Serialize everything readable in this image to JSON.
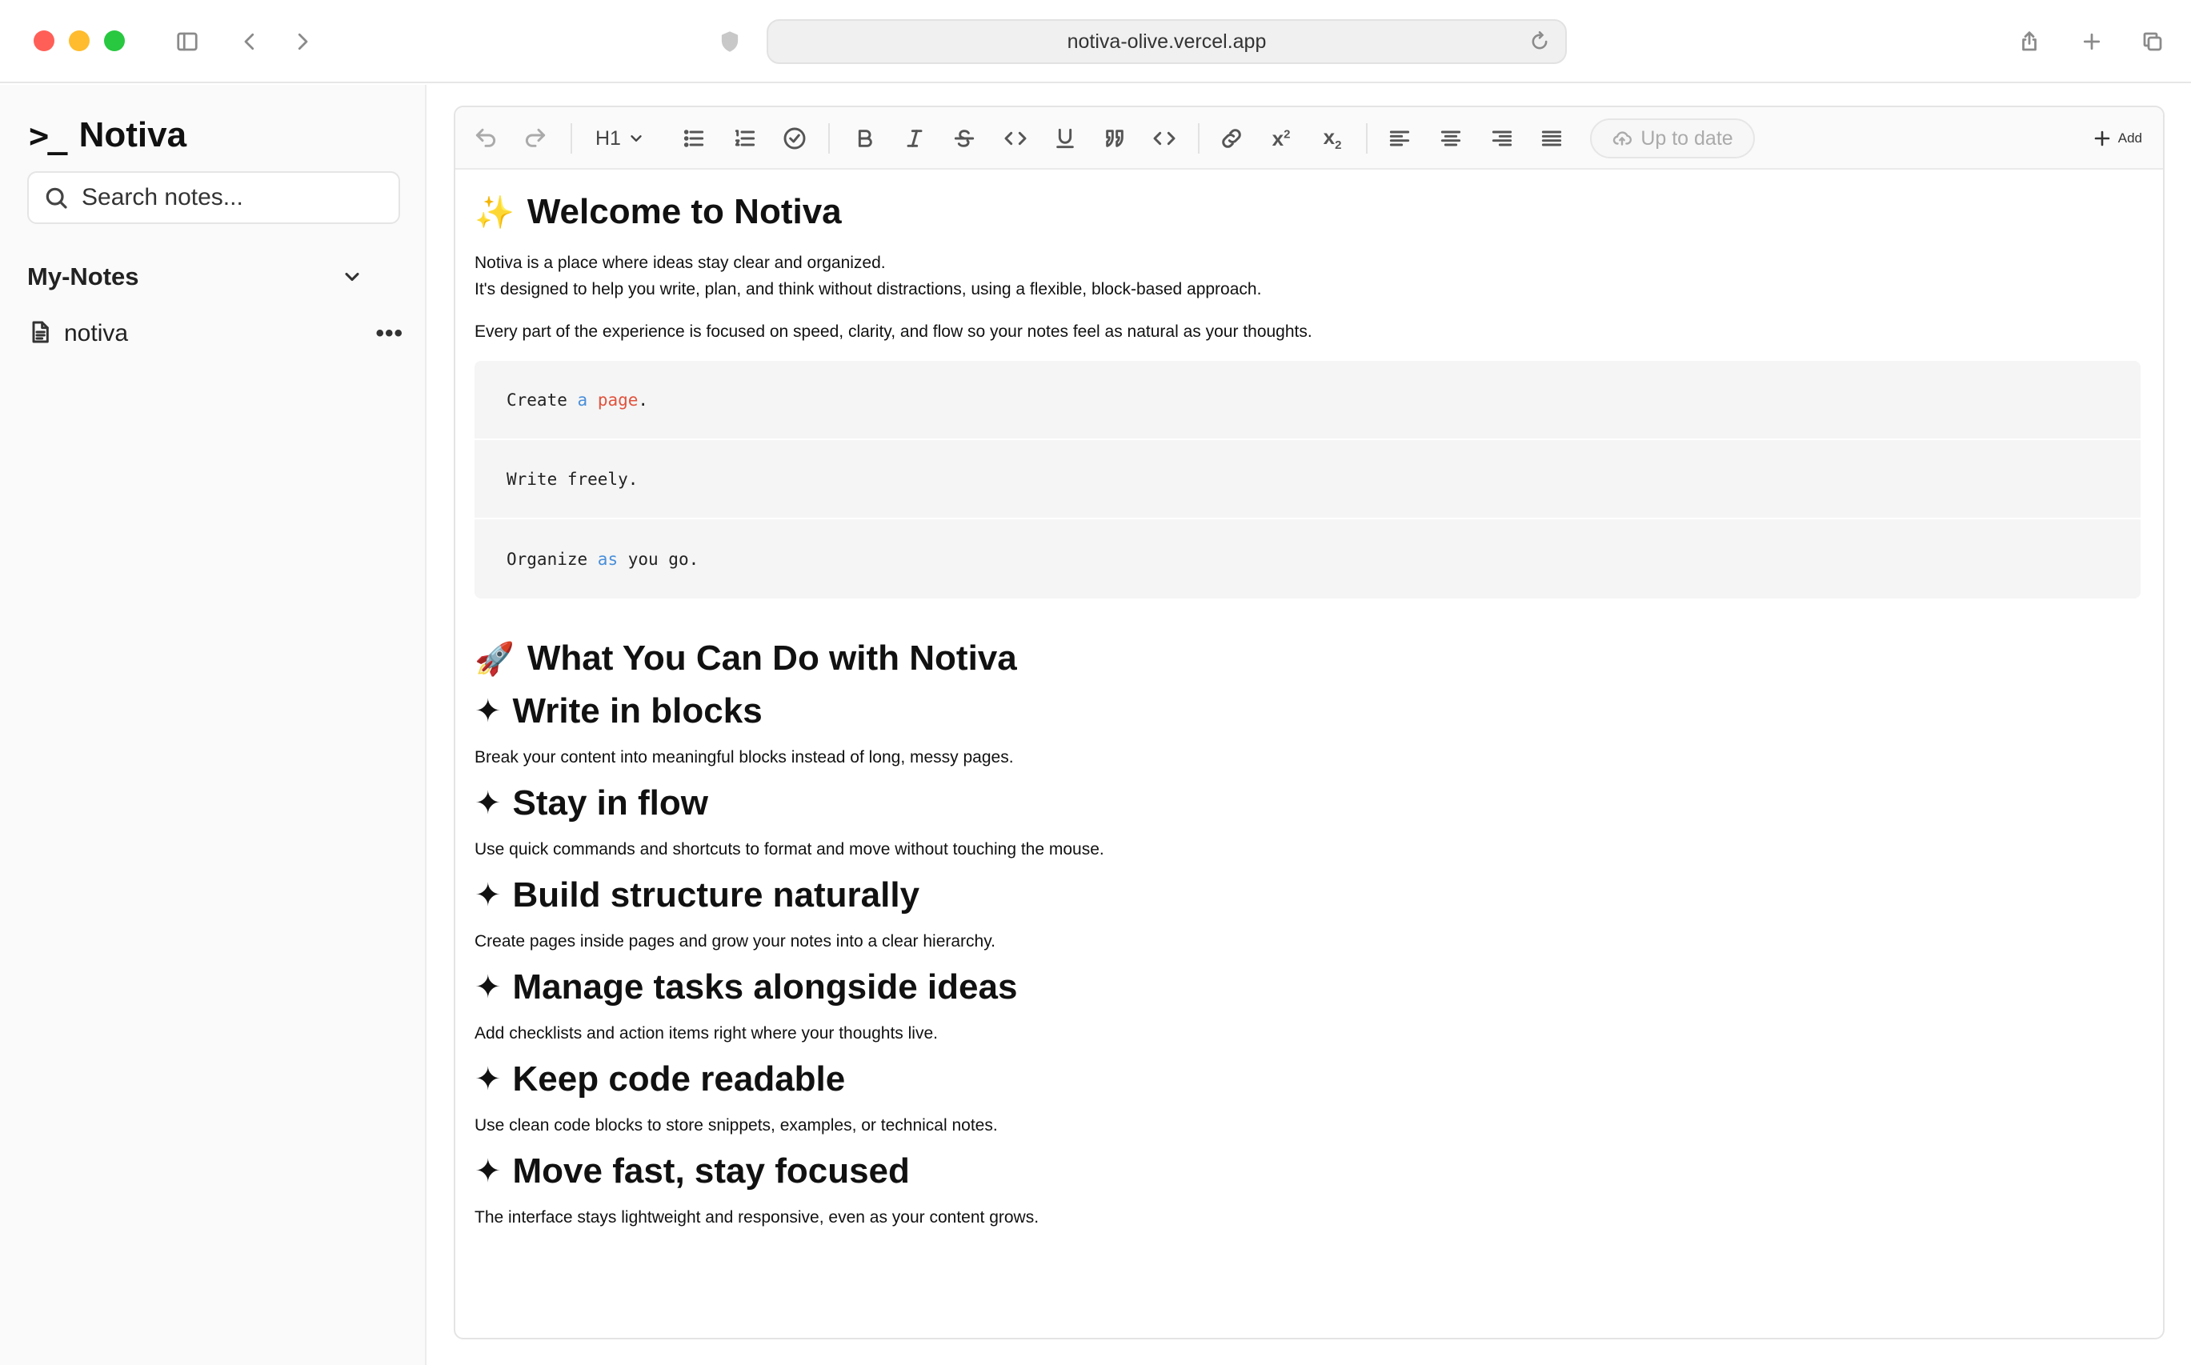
{
  "browser": {
    "url": "notiva-olive.vercel.app"
  },
  "sidebar": {
    "brand_mark": ">_",
    "brand_name": "Notiva",
    "search_placeholder": "Search notes...",
    "section_title": "My-Notes",
    "notes": [
      {
        "label": "notiva",
        "icon": "document-icon"
      }
    ],
    "more_label": "•••"
  },
  "toolbar": {
    "heading_level": "H1",
    "status": "Up to date",
    "add_label": "Add"
  },
  "document": {
    "title_emoji": "✨",
    "title": "Welcome to Notiva",
    "intro_line1": "Notiva is a place where ideas stay clear and organized.",
    "intro_line2": "It's designed to help you write, plan, and think without distractions, using a flexible, block-based approach.",
    "intro_line3": "Every part of the experience is focused on speed, clarity, and flow  so your notes feel as natural as your thoughts.",
    "code": {
      "line1_a": "Create ",
      "line1_b": "a",
      "line1_c": " ",
      "line1_d": "page",
      "line1_e": ".",
      "line2": "Write freely.",
      "line3_a": "Organize ",
      "line3_b": "as",
      "line3_c": " you go."
    },
    "section_emoji": "🚀",
    "section_title": "What You Can Do with Notiva",
    "sparkle": "✦",
    "features": [
      {
        "title": "Write in blocks",
        "desc": "Break your content into meaningful blocks instead of long, messy pages."
      },
      {
        "title": "Stay in flow",
        "desc": "Use quick commands and shortcuts to format and move without touching the mouse."
      },
      {
        "title": "Build structure naturally",
        "desc": "Create pages inside pages and grow your notes into a clear hierarchy."
      },
      {
        "title": "Manage tasks alongside ideas",
        "desc": "Add checklists and action items right where your thoughts live."
      },
      {
        "title": "Keep code readable",
        "desc": "Use clean code blocks to store snippets, examples, or technical notes."
      },
      {
        "title": "Move fast, stay focused",
        "desc": "The interface stays lightweight and responsive, even as your content grows."
      }
    ]
  }
}
